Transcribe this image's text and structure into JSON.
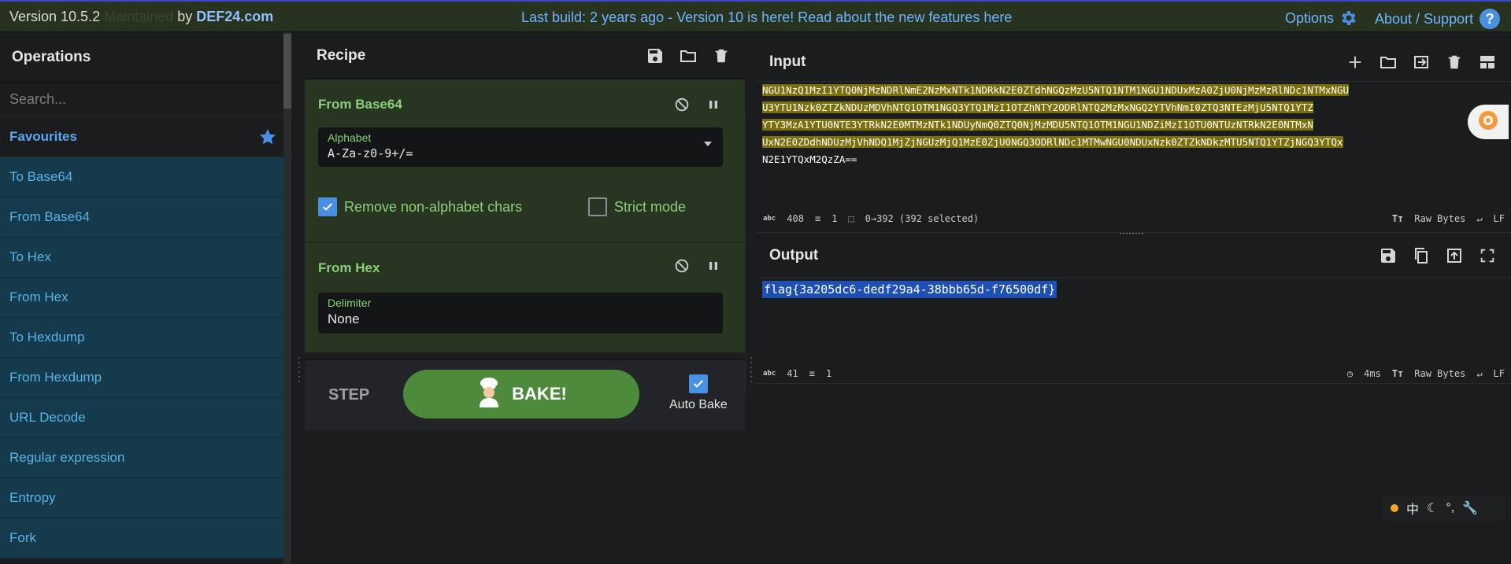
{
  "banner": {
    "version": "Version 10.5.2",
    "ghost": "Maintained",
    "by": "by",
    "brand": "DEF24.com",
    "last_build": "Last build: 2 years ago - Version 10 is here! Read about the new features here",
    "options": "Options",
    "about": "About / Support",
    "help_glyph": "?"
  },
  "operations": {
    "title": "Operations",
    "search_placeholder": "Search...",
    "favourites": "Favourites",
    "items": [
      "To Base64",
      "From Base64",
      "To Hex",
      "From Hex",
      "To Hexdump",
      "From Hexdump",
      "URL Decode",
      "Regular expression",
      "Entropy",
      "Fork"
    ]
  },
  "recipe": {
    "title": "Recipe",
    "ops": [
      {
        "name": "From Base64",
        "field_label": "Alphabet",
        "field_value": "A-Za-z0-9+/=",
        "opt1": "Remove non-alphabet chars",
        "opt2": "Strict mode"
      },
      {
        "name": "From Hex",
        "field_label": "Delimiter",
        "field_value": "None"
      }
    ],
    "step": "STEP",
    "bake": "BAKE!",
    "auto_bake": "Auto Bake"
  },
  "input": {
    "title": "Input",
    "lines": [
      "NGU1NzQ1MzI1YTQ0NjMzNDRlNmE2NzMxNTk1NDRkN2E0ZTdhNGQzMzU5NTQ1NTM1NGU1NDUxMzA0ZjU0NjMzMzRlNDc1NTMxNGU",
      "U3YTU1Nzk0ZTZkNDUzMDVhNTQ1OTM1NGQ3YTQ1MzI1OTZhNTY2ODRlNTQ2MzMxNGQ2YTVhNmI0ZTQ3NTEzMjU5NTQ1YTZ",
      "YTY3MzA1YTU0NTE3YTRkN2E0MTMzNTk1NDUyNmQ0ZTQ0NjMzMDU5NTQ1OTM1NGU1NDZiMzI1OTU0NTUzNTRkN2E0NTMxN",
      "UxN2E0ZDdhNDUzMjVhNDQ1MjZjNGUzMjQ1MzE0ZjU0NGQ3ODRlNDc1MTMwNGU0NDUxNzk0ZTZkNDkzMTU5NTQ1YTZjNGQ3YTQx"
    ],
    "tail": "N2E1YTQxM2QzZA==",
    "stats": {
      "chars": "408",
      "lines": "1",
      "selection": "0→392 (392 selected)",
      "encoding": "Raw Bytes",
      "eol": "LF"
    }
  },
  "output": {
    "title": "Output",
    "text": "flag{3a205dc6-dedf29a4-38bbb65d-f76500df}",
    "stats": {
      "chars": "41",
      "lines": "1",
      "time": "4ms",
      "encoding": "Raw Bytes",
      "eol": "LF"
    }
  },
  "tray": {
    "label": "中"
  },
  "colors": {
    "accent": "#4a90e2",
    "op_bg": "#273521",
    "op_text": "#8bcf7a",
    "fav": "#5aa8f0",
    "list_bg": "#153a4c",
    "bake": "#4d8a3c",
    "input_highlight": "#7a6f0c",
    "output_highlight": "#1d4fb5"
  }
}
